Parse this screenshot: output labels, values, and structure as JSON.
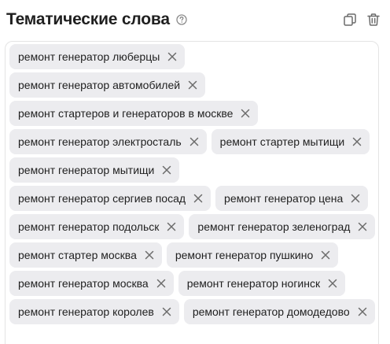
{
  "panel": {
    "title": "Тематические слова",
    "help_icon": "help-circle-icon",
    "copy_icon": "copy-icon",
    "delete_icon": "trash-icon"
  },
  "keywords": [
    "ремонт генератор люберцы",
    "ремонт генератор автомобилей",
    "ремонт стартеров и генераторов в москве",
    "ремонт генератор электросталь",
    "ремонт стартер мытищи",
    "ремонт генератор мытищи",
    "ремонт генератор сергиев посад",
    "ремонт генератор цена",
    "ремонт генератор подольск",
    "ремонт генератор зеленоград",
    "ремонт стартер москва",
    "ремонт генератор пушкино",
    "ремонт генератор москва",
    "ремонт генератор ногинск",
    "ремонт генератор королев",
    "ремонт генератор домодедово"
  ],
  "colors": {
    "chip_background": "#ececef",
    "icon": "#6b6b6b",
    "text": "#1f1f1f"
  }
}
